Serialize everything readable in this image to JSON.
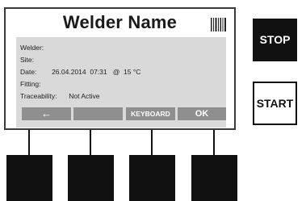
{
  "screen": {
    "title": "Welder Name",
    "fields": [
      {
        "label": "Welder:",
        "value": ""
      },
      {
        "label": "Site:",
        "value": ""
      },
      {
        "label": "Date:",
        "value": "26.04.2014  07:31   @  15 °C"
      },
      {
        "label": "Fitting:",
        "value": ""
      },
      {
        "label": "Traceability:",
        "value": "Not Active"
      }
    ],
    "softkeys": [
      "←",
      "",
      "KEYBOARD",
      "OK"
    ]
  },
  "buttons": {
    "stop": "STOP",
    "start": "START"
  },
  "icons": {
    "barcode": "barcode-icon",
    "back": "left-arrow"
  },
  "colors": {
    "panel": "#d9d9d9",
    "softkey": "#8f8f8f",
    "hardware": "#111111"
  }
}
